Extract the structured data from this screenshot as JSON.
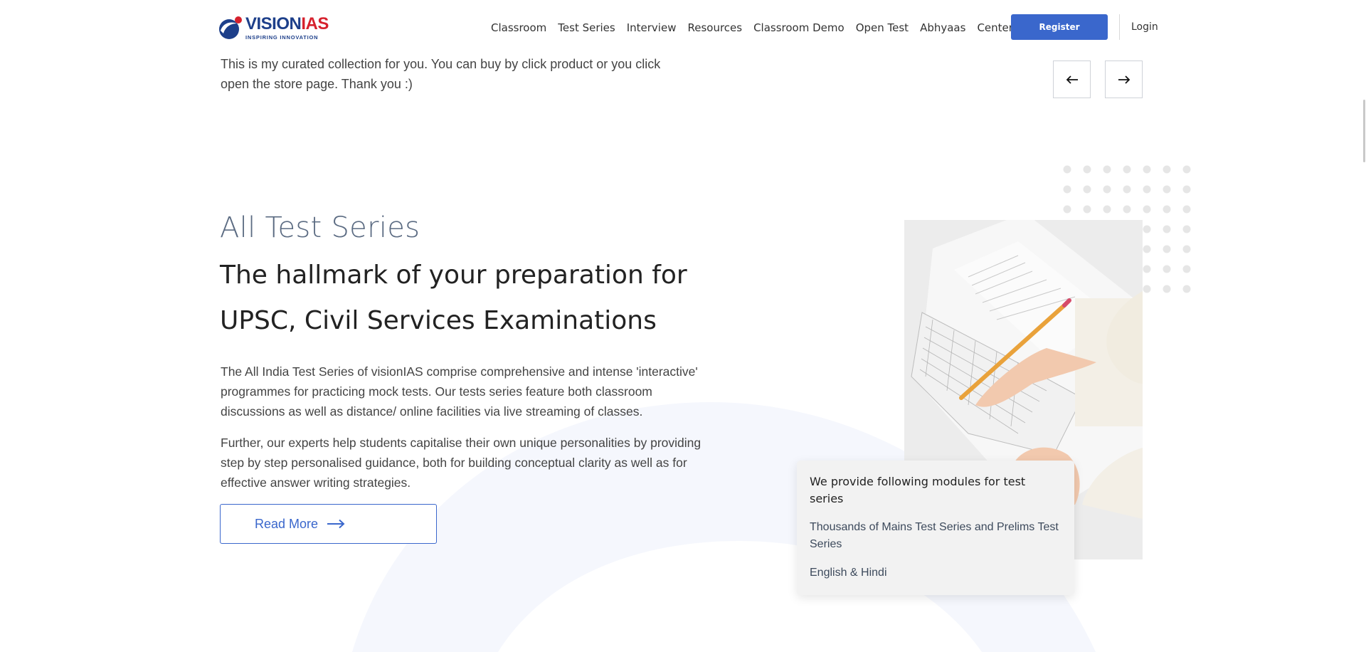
{
  "header": {
    "logo": {
      "word_part1": "VISION",
      "word_part2": "IAS",
      "tagline": "INSPIRING INNOVATION"
    },
    "nav": [
      "Classroom",
      "Test Series",
      "Interview",
      "Resources",
      "Classroom Demo",
      "Open Test",
      "Abhyaas",
      "Centers"
    ],
    "register_label": "Register",
    "login_label": "Login"
  },
  "curated": {
    "text": "This is my curated collection for you. You can buy by click product or you click open the store page. Thank you :)",
    "prev_icon": "arrow-left-icon",
    "next_icon": "arrow-right-icon"
  },
  "main": {
    "kicker": "All Test Series",
    "headline": "The hallmark of your preparation for UPSC, Civil Services Examinations",
    "paragraph1": "The All India Test Series of visionIAS comprise comprehensive and intense 'interactive' programmes for practicing mock tests. Our tests series feature both classroom discussions as well as distance/ online facilities via live streaming of classes.",
    "paragraph2": "Further, our experts help students capitalise their own unique personalities by providing step by step personalised guidance, both for building conceptual clarity as well as for effective answer writing strategies.",
    "read_more_label": "Read More"
  },
  "card": {
    "title": "We provide following modules for test series",
    "items": [
      "Thousands of Mains Test Series and Prelims Test Series",
      "English & Hindi"
    ]
  },
  "colors": {
    "accent": "#3a67cc",
    "brand_blue": "#1d3f8a",
    "brand_red": "#d6212d",
    "kicker": "#5b6b82"
  }
}
